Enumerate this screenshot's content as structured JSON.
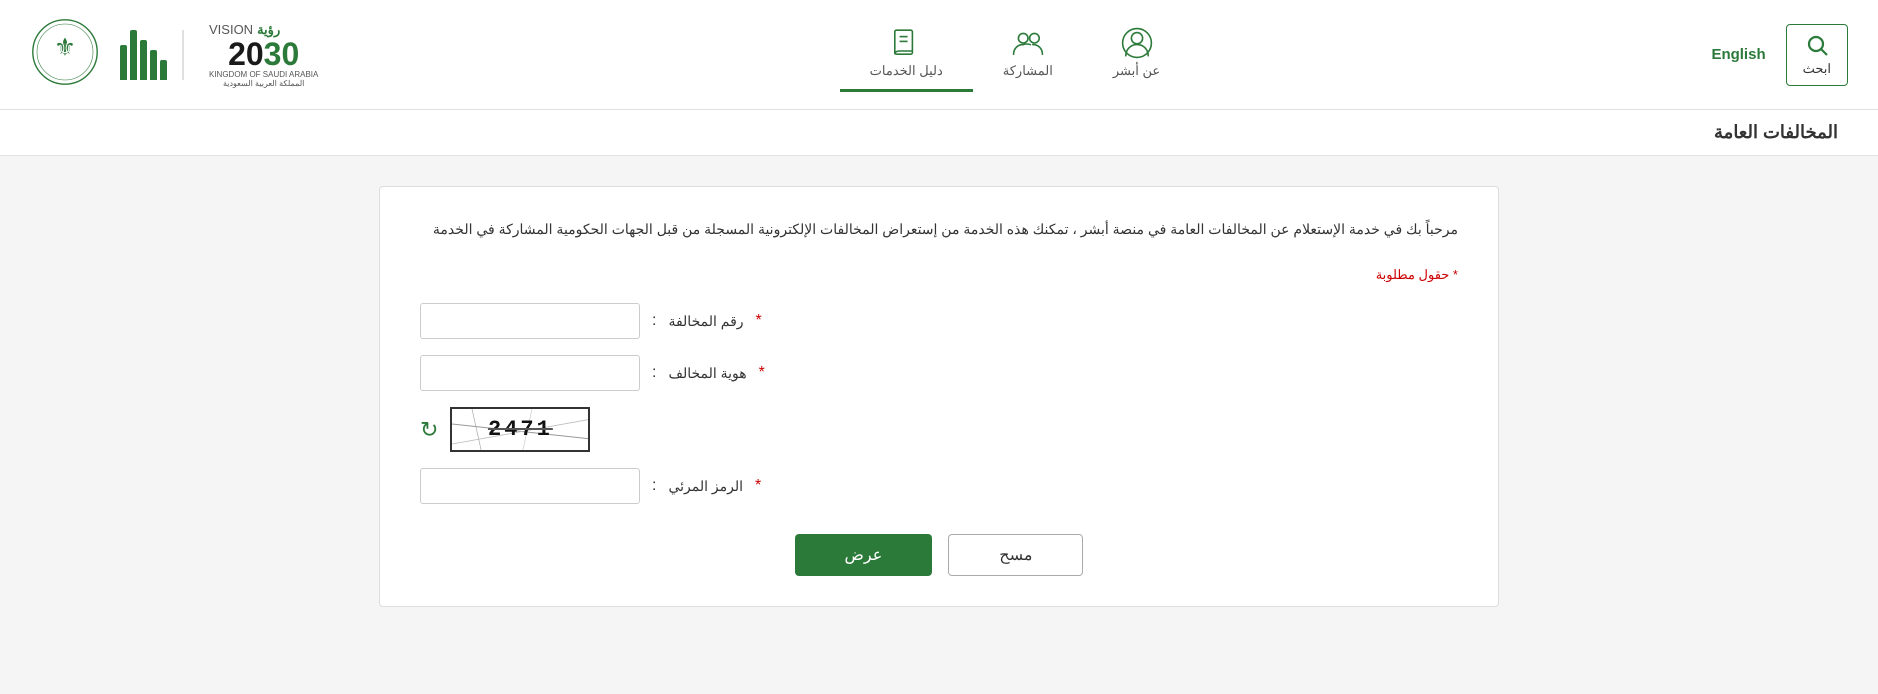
{
  "header": {
    "search_label": "ابحث",
    "english_label": "English",
    "nav_items": [
      {
        "id": "abshir",
        "label": "عن أبشر",
        "icon": "person-icon"
      },
      {
        "id": "participation",
        "label": "المشاركة",
        "icon": "people-icon"
      },
      {
        "id": "service_guide",
        "label": "دليل الخدمات",
        "icon": "book-icon"
      }
    ],
    "vision_title": "VISION",
    "vision_arabic": "رؤية",
    "vision_year": "2030",
    "vision_country": "KINGDOM OF SAUDI ARABIA",
    "abshir_name": "أبشر"
  },
  "page": {
    "title": "المخالفات العامة",
    "welcome_text": "مرحباً بك في خدمة الإستعلام عن المخالفات العامة في منصة أبشر ، تمكنك هذه الخدمة من إستعراض المخالفات الإلكترونية المسجلة من قبل الجهات الحكومية المشاركة في الخدمة",
    "required_note": "* حقول مطلوبة",
    "fields": {
      "violation_number_label": "رقم المخالفة",
      "violation_number_placeholder": "",
      "violator_id_label": "هوية المخالف",
      "violator_id_placeholder": "",
      "captcha_code": "2471",
      "captcha_label": "الرمز المرئي",
      "captcha_input_placeholder": ""
    },
    "buttons": {
      "display_label": "عرض",
      "clear_label": "مسح"
    }
  }
}
